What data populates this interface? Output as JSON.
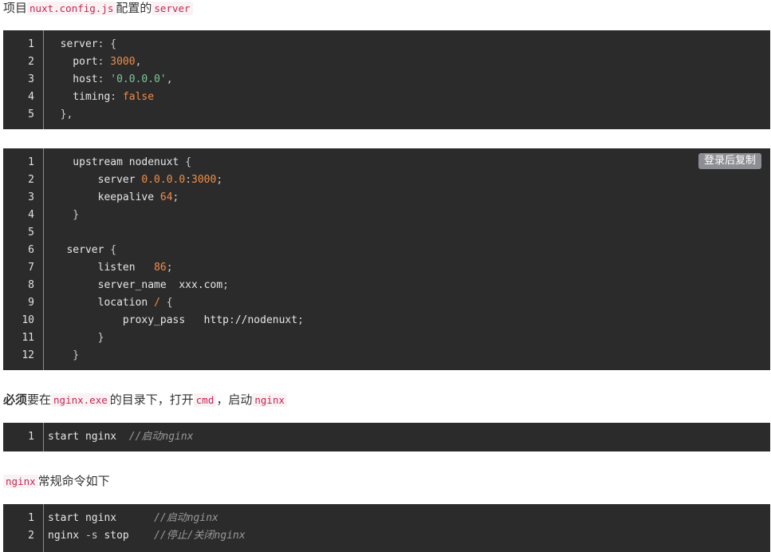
{
  "intro": {
    "prefix": "项目",
    "file": "nuxt.config.js",
    "middle": "配置的",
    "key": "server"
  },
  "block1": {
    "lines": [
      {
        "n": "1",
        "parts": [
          [
            "k",
            "  server"
          ],
          [
            "p",
            ": {"
          ]
        ]
      },
      {
        "n": "2",
        "parts": [
          [
            "k",
            "    port"
          ],
          [
            "p",
            ": "
          ],
          [
            "n",
            "3000"
          ],
          [
            "p",
            ","
          ]
        ]
      },
      {
        "n": "3",
        "parts": [
          [
            "k",
            "    host"
          ],
          [
            "p",
            ": "
          ],
          [
            "s",
            "'0.0.0.0'"
          ],
          [
            "p",
            ","
          ]
        ]
      },
      {
        "n": "4",
        "parts": [
          [
            "k",
            "    timing"
          ],
          [
            "p",
            ": "
          ],
          [
            "n",
            "false"
          ]
        ]
      },
      {
        "n": "5",
        "parts": [
          [
            "p",
            "  },"
          ]
        ]
      }
    ]
  },
  "block2": {
    "copy_label": "登录后复制",
    "lines": [
      {
        "n": "1",
        "parts": [
          [
            "k",
            "    upstream nodenuxt "
          ],
          [
            "p",
            "{"
          ]
        ]
      },
      {
        "n": "2",
        "parts": [
          [
            "k",
            "        server "
          ],
          [
            "n",
            "0.0.0.0"
          ],
          [
            "p",
            ":"
          ],
          [
            "n",
            "3000"
          ],
          [
            "p",
            ";"
          ]
        ]
      },
      {
        "n": "3",
        "parts": [
          [
            "k",
            "        keepalive "
          ],
          [
            "n",
            "64"
          ],
          [
            "p",
            ";"
          ]
        ]
      },
      {
        "n": "4",
        "parts": [
          [
            "p",
            "    }"
          ]
        ]
      },
      {
        "n": "5",
        "parts": []
      },
      {
        "n": "6",
        "parts": [
          [
            "k",
            "   server "
          ],
          [
            "p",
            "{"
          ]
        ]
      },
      {
        "n": "7",
        "parts": [
          [
            "k",
            "        listen   "
          ],
          [
            "n",
            "86"
          ],
          [
            "p",
            ";"
          ]
        ]
      },
      {
        "n": "8",
        "parts": [
          [
            "k",
            "        server_name  xxx.com"
          ],
          [
            "p",
            ";"
          ]
        ]
      },
      {
        "n": "9",
        "parts": [
          [
            "k",
            "        location "
          ],
          [
            "n",
            "/"
          ],
          [
            "p",
            " {"
          ]
        ]
      },
      {
        "n": "10",
        "parts": [
          [
            "k",
            "            proxy_pass   http"
          ],
          [
            "p",
            ":"
          ],
          [
            "k",
            "//nodenuxt"
          ],
          [
            "p",
            ";"
          ]
        ]
      },
      {
        "n": "11",
        "parts": [
          [
            "p",
            "        }"
          ]
        ]
      },
      {
        "n": "12",
        "parts": [
          [
            "p",
            "    }"
          ]
        ]
      }
    ]
  },
  "para2": {
    "bold": "必须",
    "t1": "要在",
    "exe": "nginx.exe",
    "t2": "的目录下，打开",
    "cmd": "cmd",
    "t3": "，启动",
    "ng": "nginx"
  },
  "block3": {
    "lines": [
      {
        "n": "1",
        "parts": [
          [
            "k",
            "start nginx  "
          ],
          [
            "c",
            "//启动nginx"
          ]
        ]
      }
    ]
  },
  "para3": {
    "ng": "nginx",
    "text": "常规命令如下"
  },
  "block4": {
    "lines": [
      {
        "n": "1",
        "parts": [
          [
            "k",
            "start nginx      "
          ],
          [
            "c",
            "//启动nginx"
          ]
        ]
      },
      {
        "n": "2",
        "parts": [
          [
            "k",
            "nginx "
          ],
          [
            "p",
            "-s"
          ],
          [
            "k",
            " stop    "
          ],
          [
            "c",
            "//停止/关闭nginx"
          ]
        ]
      }
    ]
  }
}
